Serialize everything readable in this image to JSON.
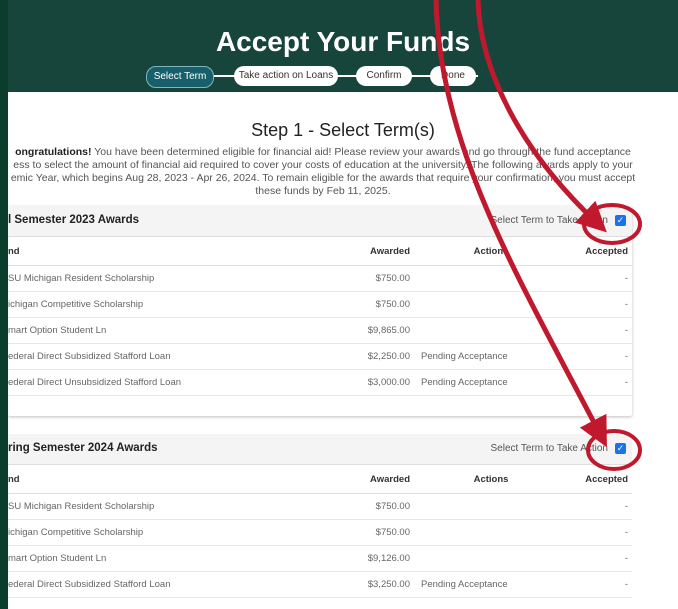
{
  "header": {
    "title": "Accept Your Funds",
    "steps": [
      "Select Term",
      "Take action on Loans",
      "Confirm",
      "Done"
    ]
  },
  "main": {
    "step_heading": "Step 1 - Select Term(s)",
    "intro_bold": "ongratulations!",
    "intro_lines": [
      "You have been determined eligible for financial aid! Please review your awards and go through the fund acceptance",
      "ess to select the amount of financial aid required to cover your costs of education at the university. The following awards apply to your",
      "emic Year, which begins Aug 28, 2023 - Apr 26, 2024. To remain eligible for the awards that require your confirmation, you must accept",
      "these funds by Feb 11, 2025."
    ]
  },
  "terms": [
    {
      "title": "l Semester 2023 Awards",
      "select_label": "Select Term to Take Action",
      "columns": [
        "nd",
        "Awarded",
        "Actions",
        "Accepted"
      ],
      "rows": [
        {
          "fund": "SU Michigan Resident Scholarship",
          "awarded": "$750.00",
          "action": "",
          "accepted": "-"
        },
        {
          "fund": "ichigan Competitive Scholarship",
          "awarded": "$750.00",
          "action": "",
          "accepted": "-"
        },
        {
          "fund": "mart Option Student Ln",
          "awarded": "$9,865.00",
          "action": "",
          "accepted": "-"
        },
        {
          "fund": "ederal Direct Subsidized Stafford Loan",
          "awarded": "$2,250.00",
          "action": "Pending Acceptance",
          "accepted": "-"
        },
        {
          "fund": "ederal Direct Unsubsidized Stafford Loan",
          "awarded": "$3,000.00",
          "action": "Pending Acceptance",
          "accepted": "-"
        }
      ]
    },
    {
      "title": "ring Semester 2024 Awards",
      "select_label": "Select Term to Take Action",
      "columns": [
        "nd",
        "Awarded",
        "Actions",
        "Accepted"
      ],
      "rows": [
        {
          "fund": "SU Michigan Resident Scholarship",
          "awarded": "$750.00",
          "action": "",
          "accepted": "-"
        },
        {
          "fund": "ichigan Competitive Scholarship",
          "awarded": "$750.00",
          "action": "",
          "accepted": "-"
        },
        {
          "fund": "mart Option Student Ln",
          "awarded": "$9,126.00",
          "action": "",
          "accepted": "-"
        },
        {
          "fund": "ederal Direct Subsidized Stafford Loan",
          "awarded": "$3,250.00",
          "action": "Pending Acceptance",
          "accepted": "-"
        },
        {
          "fund": "",
          "awarded": "",
          "action": "",
          "accepted": ""
        }
      ]
    }
  ],
  "colors": {
    "header_bg": "#18453b",
    "annotation": "#c0182c",
    "checkbox": "#1a73e8"
  }
}
